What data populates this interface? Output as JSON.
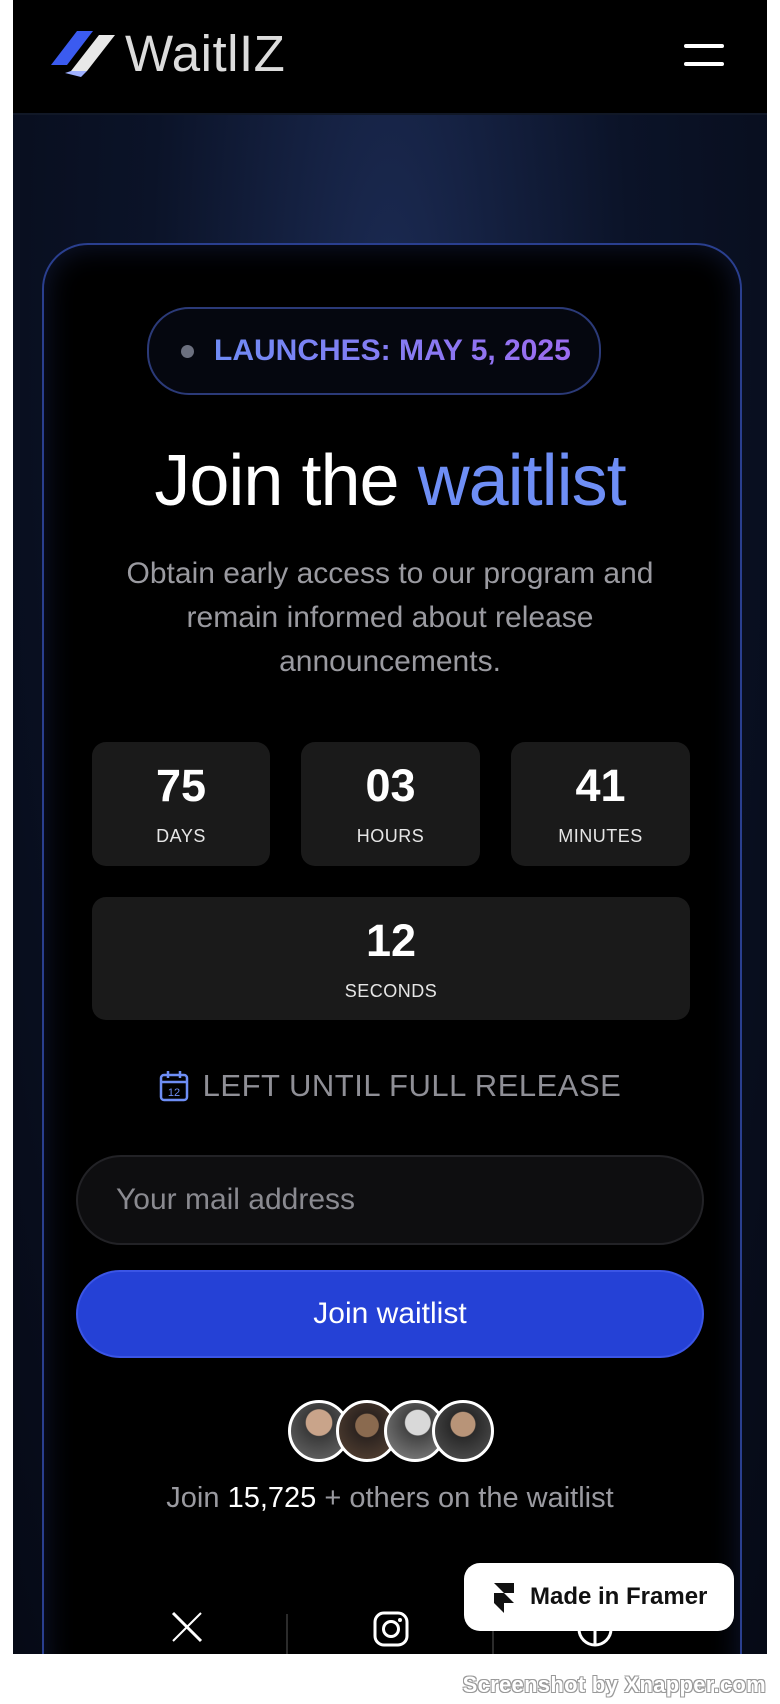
{
  "brand": {
    "name": "WaitlIZ"
  },
  "menu": {
    "icon": "hamburger-menu-icon"
  },
  "launch_badge": {
    "text": "LAUNCHES: MAY 5, 2025"
  },
  "hero": {
    "title_prefix": "Join the",
    "title_accent": "waitlist",
    "subtitle": "Obtain early access to our program and remain informed about release announcements."
  },
  "countdown": {
    "days": {
      "value": "75",
      "label": "DAYS"
    },
    "hours": {
      "value": "03",
      "label": "HOURS"
    },
    "minutes": {
      "value": "41",
      "label": "MINUTES"
    },
    "seconds": {
      "value": "12",
      "label": "SECONDS"
    }
  },
  "until": {
    "icon": "calendar-icon",
    "icon_number": "12",
    "text": "LEFT UNTIL FULL RELEASE"
  },
  "form": {
    "email_placeholder": "Your mail address",
    "email_value": "",
    "submit_label": "Join waitlist"
  },
  "social_proof": {
    "prefix": "Join",
    "count": "15,725",
    "suffix": "+ others on the waitlist"
  },
  "social_links": [
    "x-icon",
    "instagram-icon",
    "globe-icon"
  ],
  "framer_badge": {
    "label": "Made in Framer"
  },
  "watermark": "Screenshot by Xnapper.com",
  "colors": {
    "accent": "#6e8ef5",
    "button": "#2541d6",
    "badge_gradient_end": "#9b6cf0"
  }
}
